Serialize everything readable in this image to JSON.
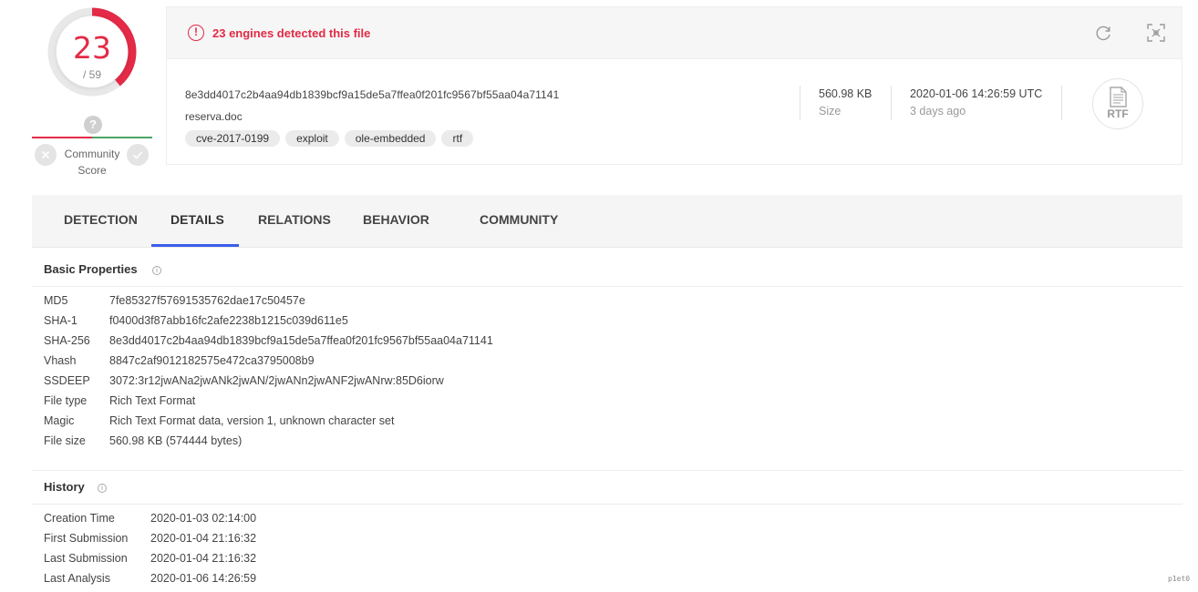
{
  "score": {
    "detections": "23",
    "total": "/ 59",
    "detection_fraction": 0.39,
    "community_unknown_glyph": "?",
    "community_label": "Community Score",
    "colors": {
      "malicious": "#e32a46",
      "harmless": "#4aa564",
      "ring_bg": "#e8e8e8"
    }
  },
  "header": {
    "alert": "23 engines detected this file",
    "sha256": "8e3dd4017c2b4aa94db1839bcf9a15de5a7ffea0f201fc9567bf55aa04a71141",
    "filename": "reserva.doc",
    "tags": [
      "cve-2017-0199",
      "exploit",
      "ole-embedded",
      "rtf"
    ],
    "size_value": "560.98 KB",
    "size_label": "Size",
    "date_value": "2020-01-06 14:26:59 UTC",
    "date_label": "3 days ago",
    "filetype_badge": "RTF",
    "icons": [
      "alert-circle-icon",
      "reload-icon",
      "expand-icon",
      "rtf-file-icon"
    ]
  },
  "tabs": [
    {
      "label": "DETECTION",
      "active": false
    },
    {
      "label": "DETAILS",
      "active": true
    },
    {
      "label": "RELATIONS",
      "active": false
    },
    {
      "label": "BEHAVIOR",
      "active": false
    },
    {
      "label": "COMMUNITY",
      "active": false
    }
  ],
  "accent_color": "#3b5eea",
  "basic_properties": {
    "title": "Basic Properties",
    "rows": [
      {
        "label": "MD5",
        "value": "7fe85327f57691535762dae17c50457e"
      },
      {
        "label": "SHA-1",
        "value": "f0400d3f87abb16fc2afe2238b1215c039d611e5"
      },
      {
        "label": "SHA-256",
        "value": "8e3dd4017c2b4aa94db1839bcf9a15de5a7ffea0f201fc9567bf55aa04a71141"
      },
      {
        "label": "Vhash",
        "value": "8847c2af9012182575e472ca3795008b9"
      },
      {
        "label": "SSDEEP",
        "value": "3072:3r12jwANa2jwANk2jwAN/2jwANn2jwANF2jwANrw:85D6iorw"
      },
      {
        "label": "File type",
        "value": "Rich Text Format"
      },
      {
        "label": "Magic",
        "value": "Rich Text Format data, version 1, unknown character set"
      },
      {
        "label": "File size",
        "value": "560.98 KB (574444 bytes)"
      }
    ]
  },
  "history": {
    "title": "History",
    "rows": [
      {
        "label": "Creation Time",
        "value": "2020-01-03 02:14:00"
      },
      {
        "label": "First Submission",
        "value": "2020-01-04 21:16:32"
      },
      {
        "label": "Last Submission",
        "value": "2020-01-04 21:16:32"
      },
      {
        "label": "Last Analysis",
        "value": "2020-01-06 14:26:59"
      }
    ]
  },
  "watermark": "p1et0"
}
